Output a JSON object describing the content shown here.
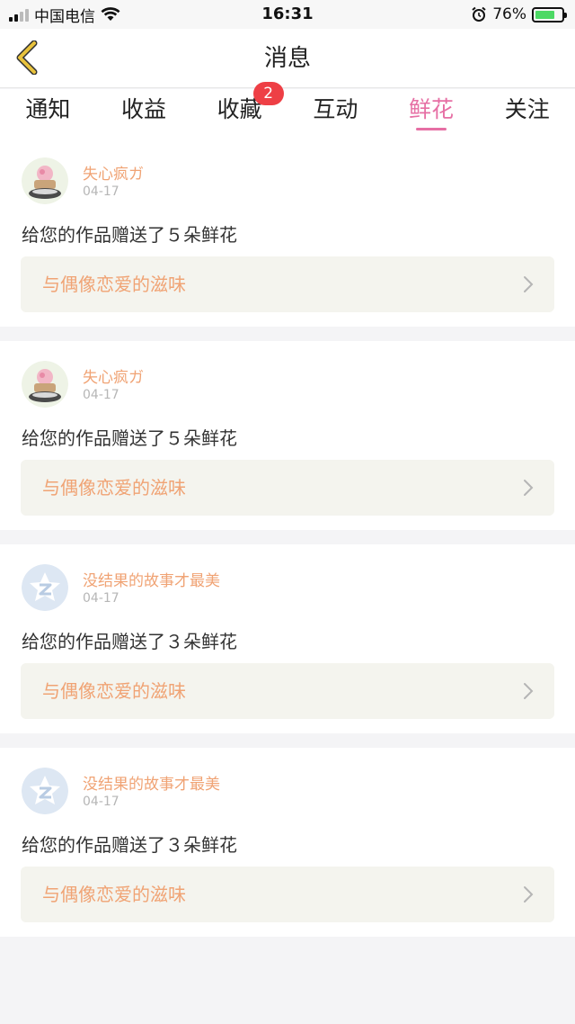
{
  "status_bar": {
    "carrier": "中国电信",
    "time": "16:31",
    "battery_pct": "76%",
    "battery_level": 0.76
  },
  "header": {
    "title": "消息",
    "back_icon": "chevron-left-icon"
  },
  "tabs": [
    {
      "label": "通知"
    },
    {
      "label": "收益"
    },
    {
      "label": "收藏",
      "badge": "2"
    },
    {
      "label": "互动"
    },
    {
      "label": "鲜花",
      "active": true
    },
    {
      "label": "关注"
    }
  ],
  "messages": [
    {
      "user": "失心疯ガ",
      "date": "04-17",
      "text": "给您的作品赠送了５朵鲜花",
      "work_title": "与偶像恋爱的滋味",
      "avatar": "cupcake-avatar"
    },
    {
      "user": "失心疯ガ",
      "date": "04-17",
      "text": "给您的作品赠送了５朵鲜花",
      "work_title": "与偶像恋爱的滋味",
      "avatar": "cupcake-avatar"
    },
    {
      "user": "没结果的故事才最美",
      "date": "04-17",
      "text": "给您的作品赠送了３朵鲜花",
      "work_title": "与偶像恋爱的滋味",
      "avatar": "default-avatar"
    },
    {
      "user": "没结果的故事才最美",
      "date": "04-17",
      "text": "给您的作品赠送了３朵鲜花",
      "work_title": "与偶像恋爱的滋味",
      "avatar": "default-avatar"
    }
  ],
  "colors": {
    "accent": "#e66fa4",
    "username": "#f0a374",
    "badge": "#ee3f45",
    "back_icon": "#e8c23c"
  }
}
